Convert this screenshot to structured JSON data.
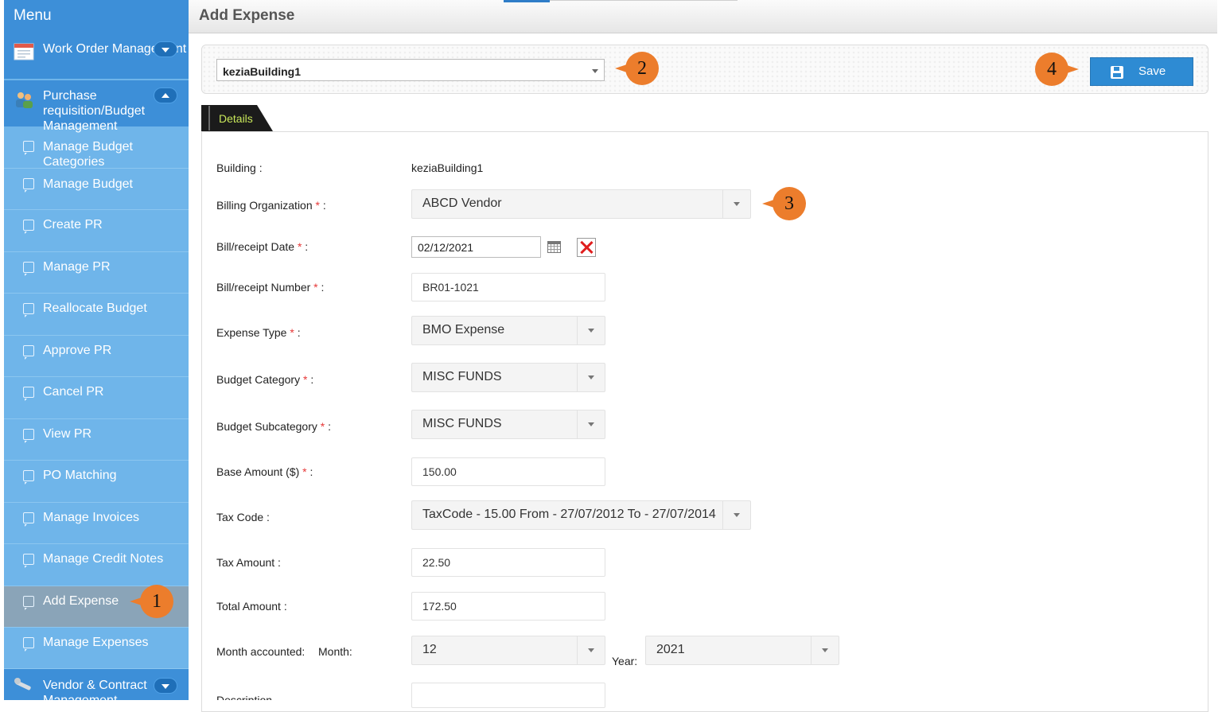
{
  "sidebar": {
    "header": "Menu",
    "groups": [
      {
        "label": "Work Order Management",
        "icon": "calendar-icon",
        "expanded": false
      },
      {
        "label": "Purchase requisition/Budget Management",
        "icon": "users-icon",
        "expanded": true
      },
      {
        "label": "Vendor & Contract Management",
        "icon": "tools-icon",
        "expanded": false
      }
    ],
    "items": [
      {
        "label": "Manage Budget Categories"
      },
      {
        "label": "Manage Budget"
      },
      {
        "label": "Create PR"
      },
      {
        "label": "Manage PR"
      },
      {
        "label": "Reallocate Budget"
      },
      {
        "label": "Approve PR"
      },
      {
        "label": "Cancel PR"
      },
      {
        "label": "View PR"
      },
      {
        "label": "PO Matching"
      },
      {
        "label": "Manage Invoices"
      },
      {
        "label": "Manage Credit Notes"
      },
      {
        "label": "Add Expense",
        "active": true
      },
      {
        "label": "Manage Expenses"
      }
    ]
  },
  "page": {
    "title": "Add Expense"
  },
  "toolbar": {
    "building_selected": "keziaBuilding1",
    "save_label": "Save"
  },
  "tabs": [
    {
      "label": "Details",
      "active": true
    }
  ],
  "form": {
    "building": {
      "label": "Building :",
      "value": "keziaBuilding1"
    },
    "billing_org": {
      "label": "Billing Organization",
      "value": "ABCD Vendor"
    },
    "bill_date": {
      "label": "Bill/receipt Date",
      "value": "02/12/2021"
    },
    "bill_number": {
      "label": "Bill/receipt Number",
      "value": "BR01-1021"
    },
    "expense_type": {
      "label": "Expense Type",
      "value": "BMO Expense"
    },
    "budget_category": {
      "label": "Budget Category",
      "value": "MISC FUNDS"
    },
    "budget_subcategory": {
      "label": "Budget Subcategory",
      "value": "MISC FUNDS"
    },
    "base_amount": {
      "label": "Base Amount ($)",
      "value": "150.00"
    },
    "tax_code": {
      "label": "Tax Code :",
      "value": "TaxCode - 15.00 From - 27/07/2012 To - 27/07/2014"
    },
    "tax_amount": {
      "label": "Tax Amount :",
      "value": "22.50"
    },
    "total_amount": {
      "label": "Total Amount :",
      "value": "172.50"
    },
    "month_accounted": {
      "label": "Month accounted:",
      "month_label": "Month:",
      "month_value": "12",
      "year_label": "Year:",
      "year_value": "2021"
    },
    "description": {
      "label": "Description"
    }
  },
  "required_marker": "*",
  "label_suffix": ":",
  "callouts": [
    "1",
    "2",
    "3",
    "4"
  ],
  "colors": {
    "sidebar_bg": "#6fb5ea",
    "sidebar_header": "#3d8fd8",
    "save_button": "#2e8bd3",
    "callout": "#ec7d2c",
    "required": "#e63838",
    "tab_label": "#c9e85a"
  }
}
